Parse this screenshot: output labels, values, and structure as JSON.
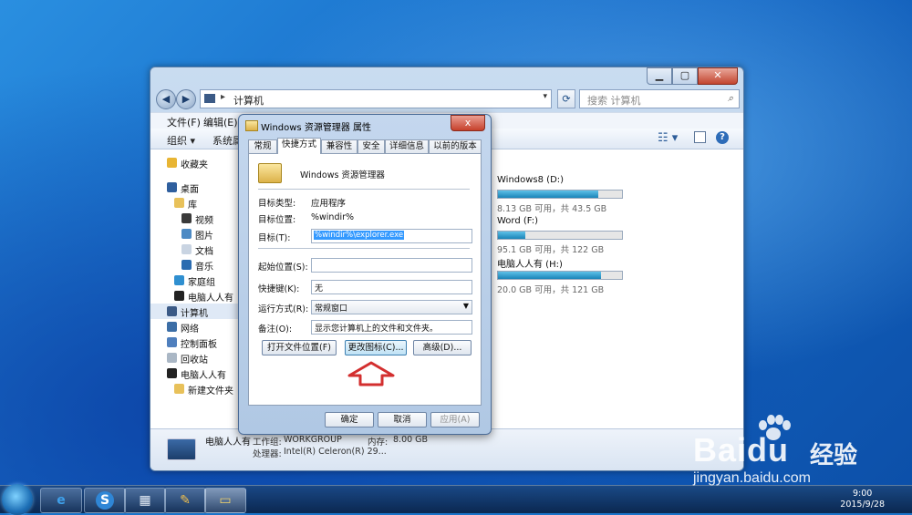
{
  "explorer": {
    "address_text": "计算机",
    "search_placeholder": "搜索 计算机",
    "menu": [
      "文件(F)",
      "编辑(E)"
    ],
    "cmd": {
      "organize": "组织 ▾",
      "system": "系统属"
    },
    "nav": [
      {
        "label": "收藏夹",
        "icon": "star-icon",
        "color": "#e8b534"
      },
      {
        "label": "桌面",
        "icon": "desktop-icon",
        "color": "#2f5f9e"
      },
      {
        "label": "库",
        "icon": "library-icon",
        "color": "#e8c15a"
      },
      {
        "label": "视频",
        "icon": "video-icon",
        "color": "#3a3a3a"
      },
      {
        "label": "图片",
        "icon": "pictures-icon",
        "color": "#4d8ac4"
      },
      {
        "label": "文档",
        "icon": "documents-icon",
        "color": "#c9d4e2"
      },
      {
        "label": "音乐",
        "icon": "music-icon",
        "color": "#2b6cb0"
      },
      {
        "label": "家庭组",
        "icon": "homegroup-icon",
        "color": "#2f8fd0"
      },
      {
        "label": "电脑人人有",
        "icon": "user-icon",
        "color": "#222222"
      },
      {
        "label": "计算机",
        "icon": "computer-icon",
        "color": "#3b5a86"
      },
      {
        "label": "网络",
        "icon": "network-icon",
        "color": "#3c6ea6"
      },
      {
        "label": "控制面板",
        "icon": "control-panel-icon",
        "color": "#4f7fbd"
      },
      {
        "label": "回收站",
        "icon": "recycle-bin-icon",
        "color": "#aab7c5"
      },
      {
        "label": "电脑人人有",
        "icon": "user-icon",
        "color": "#222222"
      },
      {
        "label": "新建文件夹",
        "icon": "folder-icon",
        "color": "#e8c15a"
      }
    ],
    "drives": [
      {
        "name": "Windows8 (D:)",
        "info": "8.13 GB 可用，共 43.5 GB",
        "used_fraction": 0.81
      },
      {
        "name": "Word (F:)",
        "info": "95.1 GB 可用，共 122 GB",
        "used_fraction": 0.22
      },
      {
        "name": "电脑人人有 (H:)",
        "info": "20.0 GB 可用，共 121 GB",
        "used_fraction": 0.83
      }
    ],
    "details": {
      "name": "电脑人人有",
      "workgroup_label": "工作组:",
      "workgroup": "WORKGROUP",
      "memory_label": "内存:",
      "memory": "8.00 GB",
      "cpu_label": "处理器:",
      "cpu": "Intel(R) Celeron(R) 29..."
    }
  },
  "dialog": {
    "title": "Windows 资源管理器 属性",
    "close": "x",
    "tabs": [
      "常规",
      "快捷方式",
      "兼容性",
      "安全",
      "详细信息",
      "以前的版本"
    ],
    "active_tab": "快捷方式",
    "app_name": "Windows 资源管理器",
    "target_type_label": "目标类型:",
    "target_type": "应用程序",
    "target_location_label": "目标位置:",
    "target_location": "%windir%",
    "target_label": "目标(T):",
    "target_value": "%windir%\\explorer.exe",
    "start_in_label": "起始位置(S):",
    "start_in_value": "",
    "hotkey_label": "快捷键(K):",
    "hotkey_value": "无",
    "run_label": "运行方式(R):",
    "run_value": "常规窗口",
    "comment_label": "备注(O):",
    "comment_value": "显示您计算机上的文件和文件夹。",
    "btn_open_location": "打开文件位置(F)",
    "btn_change_icon": "更改图标(C)...",
    "btn_advanced": "高级(D)...",
    "btn_ok": "确定",
    "btn_cancel": "取消",
    "btn_apply": "应用(A)"
  },
  "taskbar": {
    "items": [
      "internet-explorer-icon",
      "sogou-icon",
      "control-panel-icon",
      "paint-icon",
      "explorer-icon"
    ],
    "time": "9:00",
    "date": "2015/9/28"
  },
  "watermark": {
    "brand": "Baidu",
    "product": "经验",
    "url": "jingyan.baidu.com"
  },
  "colors": {
    "drive_fill": "#1a84b8",
    "highlight_arrow": "#d32f2f",
    "selection": "#3399ff"
  }
}
